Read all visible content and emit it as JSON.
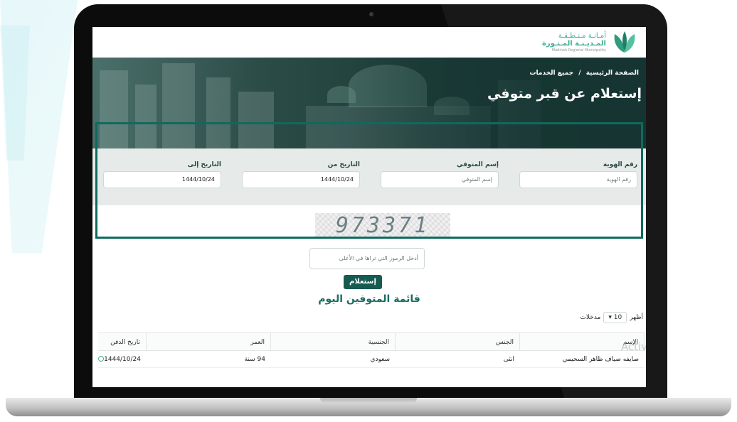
{
  "brand": {
    "line1": "أمـانـة مـنـطـقـة",
    "line2": "المـديـنـة المـنـورة",
    "line3": "Madinah Regional Municipality",
    "color": "#3fae8f"
  },
  "breadcrumb": {
    "home": "الصفحة الرئيسية",
    "separator": "/",
    "current": "جميع الخدمات"
  },
  "page_title": "إستعلام عن قبر متوفي",
  "form": {
    "id_number": {
      "label": "رقم الهوية",
      "placeholder": "رقم الهوية"
    },
    "deceased_name": {
      "label": "إسم المتوفي",
      "placeholder": "إسم المتوفي"
    },
    "date_from": {
      "label": "التاريخ من",
      "value": "1444/10/24"
    },
    "date_to": {
      "label": "التاريخ إلى",
      "value": "1444/10/24"
    }
  },
  "captcha": {
    "code": "973371",
    "placeholder": "أدخل الرموز التي تراها في الأعلى"
  },
  "submit_label": "إستعلام",
  "list_title": "قائمة المتوفين اليوم",
  "entries": {
    "show": "أظهر",
    "count": "10",
    "suffix": "مدخلات"
  },
  "table": {
    "headers": [
      "الإسم",
      "الجنس",
      "الجنسية",
      "العمر",
      "تاريخ الدفن"
    ],
    "rows": [
      [
        "صايفه صياف ظاهر السحيمي",
        "انثى",
        "سعودي",
        "94 سنة",
        "1444/10/24"
      ]
    ]
  },
  "watermark": "Activ",
  "colors": {
    "accent": "#165b52",
    "highlight": "#0d6b5e",
    "title": "#1b6e61"
  }
}
